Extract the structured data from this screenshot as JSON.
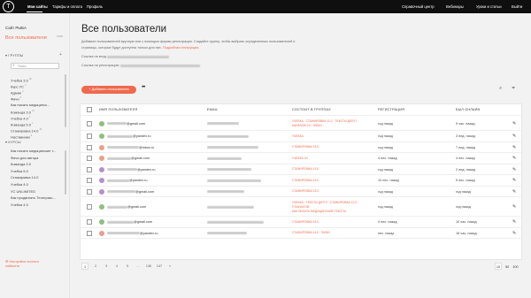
{
  "topnav": {
    "items": [
      "Мои сайты",
      "Тарифы и оплата",
      "Профиль"
    ],
    "right": [
      "Справочный центр",
      "Вебинары",
      "Уроки и статьи",
      "Выйти"
    ]
  },
  "sidebar": {
    "site_title": "Сайт РЫБА",
    "all_users": "Все пользователи",
    "all_users_count": "1458",
    "groups_heading": "ГРУППЫ",
    "search_placeholder": "Поиск",
    "groups": [
      {
        "label": "Учебка 3.0",
        "count": "30"
      },
      {
        "label": "Курс УС",
        "count": "2"
      },
      {
        "label": "Админ",
        "count": "2"
      },
      {
        "label": "Фичи",
        "count": "2"
      },
      {
        "label": "Как писать медицинск...",
        "count": ""
      },
      {
        "label": "Команда 3.0",
        "count": "21"
      },
      {
        "label": "Учебка 4.0",
        "count": "5"
      },
      {
        "label": "Команда 5.0",
        "count": "9"
      },
      {
        "label": "Стажировка 14.0",
        "count": "15"
      },
      {
        "label": "Наставники",
        "count": "9"
      }
    ],
    "courses_heading": "КУРСЫ",
    "courses": [
      "Как писать медицинские т...",
      "Фичи для автора",
      "Команда 3.0",
      "Учебка 5.0",
      "Стажировка 14.0",
      "Учебка 4.0",
      "УС UNLIMITED",
      "Как продвигать Телеграм-...",
      "Учебка 4.0"
    ],
    "settings": "Настройки личного кабинета"
  },
  "main": {
    "title": "Все пользователи",
    "desc1": "Добавьте пользователей вручную или с помощью формы регистрации. Создайте группу, чтобы выбрать определенных пользователей и",
    "desc2_start": "страницы, которые будут доступны только для них.",
    "desc2_link": "Подробная инструкция.",
    "login_label": "Ссылка на вход",
    "reg_label": "Ссылка на регистрацию",
    "add_button": "+ Добавить пользователя",
    "more": "•••"
  },
  "table": {
    "columns": [
      "ИМЯ ПОЛЬЗОВАТЕЛЯ",
      "EMAIL",
      "СОСТОИТ В ГРУППАХ",
      "РЕГИСТРАЦИЯ",
      "БЫЛ ОНЛАЙН"
    ],
    "rows": [
      {
        "email": "@gmail.com",
        "groups": [
          "УЧЕБКА · СТАЖИРОВКА 11.0 · ТЕКСТЫ ДЛЯ П ·",
          "КАНАЛОВ 2.0 · ФИЧИ"
        ],
        "reg": "год назад",
        "online": "9 час. назад",
        "av": "#8fbf7f"
      },
      {
        "email": "@yandex.ru",
        "groups": [
          "УЧЕБКА"
        ],
        "reg": "год назад",
        "online": "3 нед. назад",
        "av": "#8fbf7f"
      },
      {
        "email": "@inbox.ru",
        "groups": [
          "СТАЖИРОВКА 13.0"
        ],
        "reg": "год назад",
        "online": "7 нед. назад",
        "av": "#e8a089"
      },
      {
        "email": "@gmail.com",
        "groups": [
          "УЧЕБКА 3.0"
        ],
        "reg": "4 нес. назад",
        "online": "4 нес. назад",
        "av": "#e8a089"
      },
      {
        "email": "@yandex.ru",
        "groups": [
          "СТАЖИРОВКА 13.0"
        ],
        "reg": "год назад",
        "online": "2 нед. назад",
        "av": "#b68fc9"
      },
      {
        "email": "@yandex.ru",
        "groups": [
          "СТАЖИРОВКА 13.0"
        ],
        "reg": "10 нес. назад",
        "online": "5 нес. назад",
        "av": "#b68fc9"
      },
      {
        "email": "@gmail.com",
        "groups": [
          "СТАЖИРОВКА 13.0"
        ],
        "reg": "год назад",
        "online": "год назад",
        "av": "#b68fc9"
      },
      {
        "email": "@gmail.com",
        "groups": [
          "УЧЕБКА · ТЕКСТЫ ДЛЯ П · СТАЖИРОВКА 12.0 ·",
          "П КАНАЛОВ ·",
          "КАК ПИСАТЬ МЕДИЦИНСКИЕ ТЕКСТЫ"
        ],
        "reg": "год назад",
        "online": "год назад",
        "av": "#8fbf7f"
      },
      {
        "email": "@gmail.com",
        "groups": [
          "СТАЖИРОВКА 14.0"
        ],
        "reg": "4 нес. назад",
        "online": "10 час. назад",
        "av": "#8fbf7f"
      },
      {
        "email": "@yandex.ru",
        "groups": [
          "СТАЖИРОВКА 14.0 · ФИЧИ"
        ],
        "reg": "нес. назад",
        "online": "18 час. назад",
        "av": "#e8a089"
      }
    ]
  },
  "pager": {
    "pages": [
      "1",
      "2",
      "3",
      "4",
      "5",
      "...",
      "146",
      "147",
      "»"
    ],
    "per_page": [
      "10",
      "50",
      "100"
    ]
  }
}
